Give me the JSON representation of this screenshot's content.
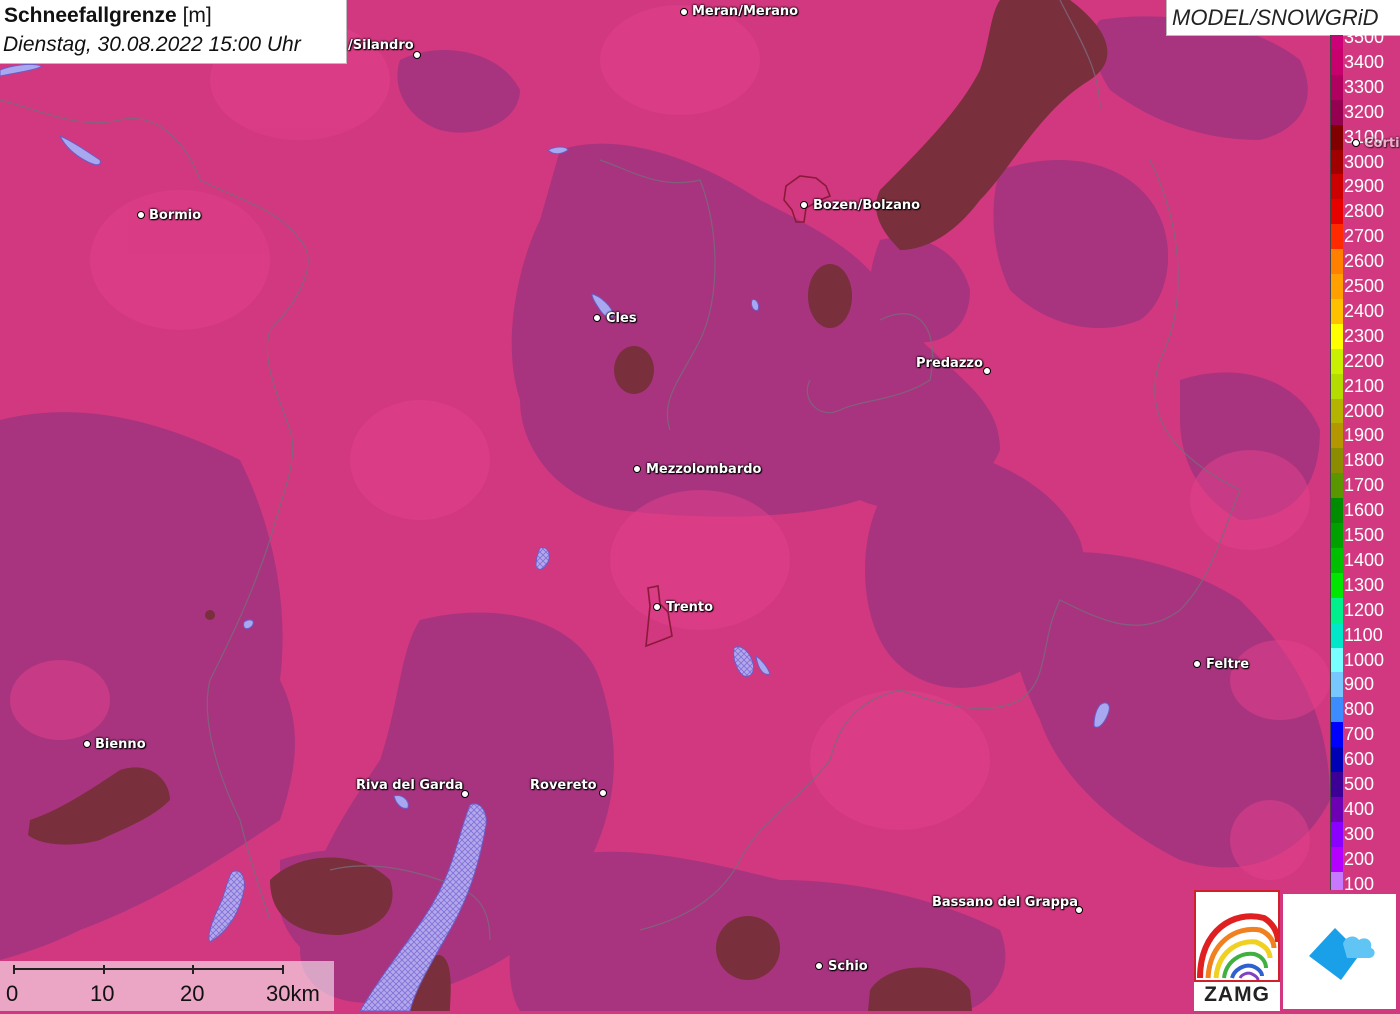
{
  "title": {
    "main": "Schneefallgrenze",
    "unit": "[m]",
    "date": "Dienstag, 30.08.2022 15:00 Uhr"
  },
  "model_label": "MODEL/SNOWGRiD",
  "legend": {
    "levels": [
      {
        "value": "3500",
        "color": "#cc0077"
      },
      {
        "value": "3400",
        "color": "#c8006e"
      },
      {
        "value": "3300",
        "color": "#b00060"
      },
      {
        "value": "3200",
        "color": "#950050"
      },
      {
        "value": "3100",
        "color": "#800000"
      },
      {
        "value": "3000",
        "color": "#a00000"
      },
      {
        "value": "2900",
        "color": "#cc0000"
      },
      {
        "value": "2800",
        "color": "#e60000"
      },
      {
        "value": "2700",
        "color": "#ff2a00"
      },
      {
        "value": "2600",
        "color": "#ff8000"
      },
      {
        "value": "2500",
        "color": "#ffa000"
      },
      {
        "value": "2400",
        "color": "#ffc000"
      },
      {
        "value": "2300",
        "color": "#ffff00"
      },
      {
        "value": "2200",
        "color": "#c8f000"
      },
      {
        "value": "2100",
        "color": "#b4dc00"
      },
      {
        "value": "2000",
        "color": "#b4b400"
      },
      {
        "value": "1900",
        "color": "#b49600"
      },
      {
        "value": "1800",
        "color": "#8c8c00"
      },
      {
        "value": "1700",
        "color": "#5a9600"
      },
      {
        "value": "1600",
        "color": "#008c00"
      },
      {
        "value": "1500",
        "color": "#00a000"
      },
      {
        "value": "1400",
        "color": "#00be00"
      },
      {
        "value": "1300",
        "color": "#00e600"
      },
      {
        "value": "1200",
        "color": "#00f08c"
      },
      {
        "value": "1100",
        "color": "#00e6c8"
      },
      {
        "value": "1000",
        "color": "#78ffff"
      },
      {
        "value": "900",
        "color": "#78c8ff"
      },
      {
        "value": "800",
        "color": "#3c8cff"
      },
      {
        "value": "700",
        "color": "#0000ff"
      },
      {
        "value": "600",
        "color": "#0000b4"
      },
      {
        "value": "500",
        "color": "#3c0096"
      },
      {
        "value": "400",
        "color": "#6e00b4"
      },
      {
        "value": "300",
        "color": "#8c00ff"
      },
      {
        "value": "200",
        "color": "#b400ff"
      },
      {
        "value": "100",
        "color": "#c878ff"
      }
    ]
  },
  "places": [
    {
      "name": "Meran/Merano"
    },
    {
      "name": "/Silandro"
    },
    {
      "name": "Bormio"
    },
    {
      "name": "Bozen/Bolzano"
    },
    {
      "name": "Cles"
    },
    {
      "name": "Predazzo"
    },
    {
      "name": "Mezzolombardo"
    },
    {
      "name": "Trento"
    },
    {
      "name": "Feltre"
    },
    {
      "name": "Bienno"
    },
    {
      "name": "Riva del Garda"
    },
    {
      "name": "Rovereto"
    },
    {
      "name": "Bassano del Grappa"
    },
    {
      "name": "Schio"
    },
    {
      "name": "Corti"
    }
  ],
  "scale": {
    "labels": [
      "0",
      "10",
      "20",
      "30km"
    ]
  },
  "logos": {
    "zamg": "ZAMG"
  },
  "colors": {
    "snowline_bright": "#d2387f",
    "snowline_purple": "#a8337e",
    "snowline_brown": "#7a2f3c",
    "lake": "#a8a8f0"
  }
}
